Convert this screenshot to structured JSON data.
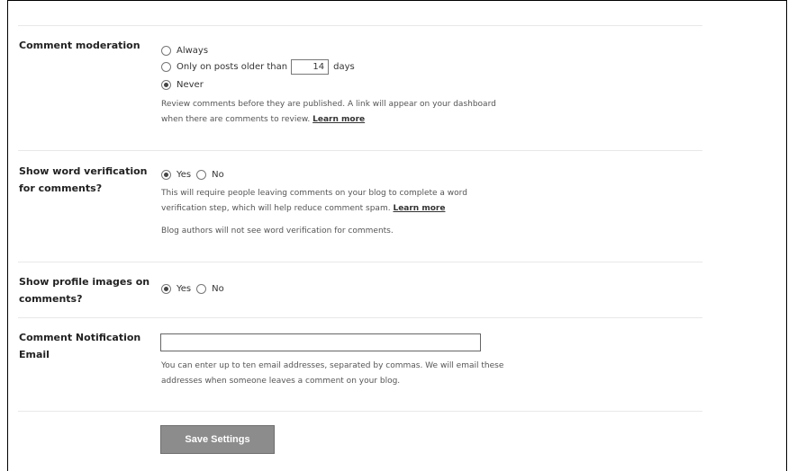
{
  "moderation": {
    "label": "Comment moderation",
    "options": {
      "always": "Always",
      "older_prefix": "Only on posts older than",
      "older_days": "14",
      "older_suffix": "days",
      "never": "Never"
    },
    "selected": "never",
    "desc": "Review comments before they are published. A link will appear on your dashboard when there are comments to review.",
    "learn_more": "Learn more"
  },
  "word_verification": {
    "label_line1": "Show word verification",
    "label_line2": "for comments?",
    "yes": "Yes",
    "no": "No",
    "selected": "yes",
    "desc": "This will require people leaving comments on your blog to complete a word verification step, which will help reduce comment spam.",
    "learn_more": "Learn more",
    "note": "Blog authors will not see word verification for comments."
  },
  "profile_images": {
    "label_line1": "Show profile images on",
    "label_line2": "comments?",
    "yes": "Yes",
    "no": "No",
    "selected": "yes"
  },
  "notification_email": {
    "label_line1": "Comment Notification",
    "label_line2": "Email",
    "value": "",
    "desc": "You can enter up to ten email addresses, separated by commas. We will email these addresses when someone leaves a comment on your blog."
  },
  "save_button": "Save Settings"
}
